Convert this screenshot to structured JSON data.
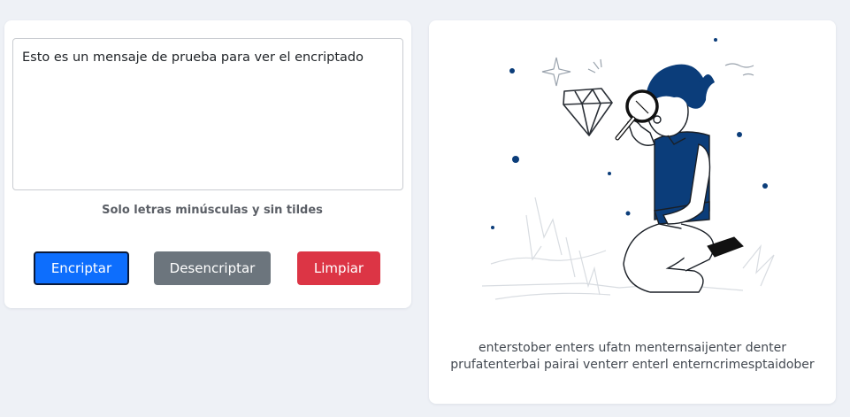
{
  "input": {
    "value": "Esto es un mensaje de prueba para ver el encriptado"
  },
  "hint": "Solo letras minúsculas y sin tildes",
  "buttons": {
    "encrypt_label": "Encriptar",
    "decrypt_label": "Desencriptar",
    "clear_label": "Limpiar"
  },
  "output": {
    "line1": "enterstober enters ufatn menternsaijenter denter",
    "line2": "prufatenterbai pairai venterr enterl enterncrimesptaidober"
  },
  "colors": {
    "page_background": "#eef1f6",
    "card_background": "#ffffff",
    "primary": "#0d6efd",
    "secondary": "#6c757d",
    "danger": "#dc3545",
    "illustration_accent": "#0b3d7a"
  },
  "icons": {
    "illustration": "person-with-magnifying-glass-diamond-illustration"
  }
}
